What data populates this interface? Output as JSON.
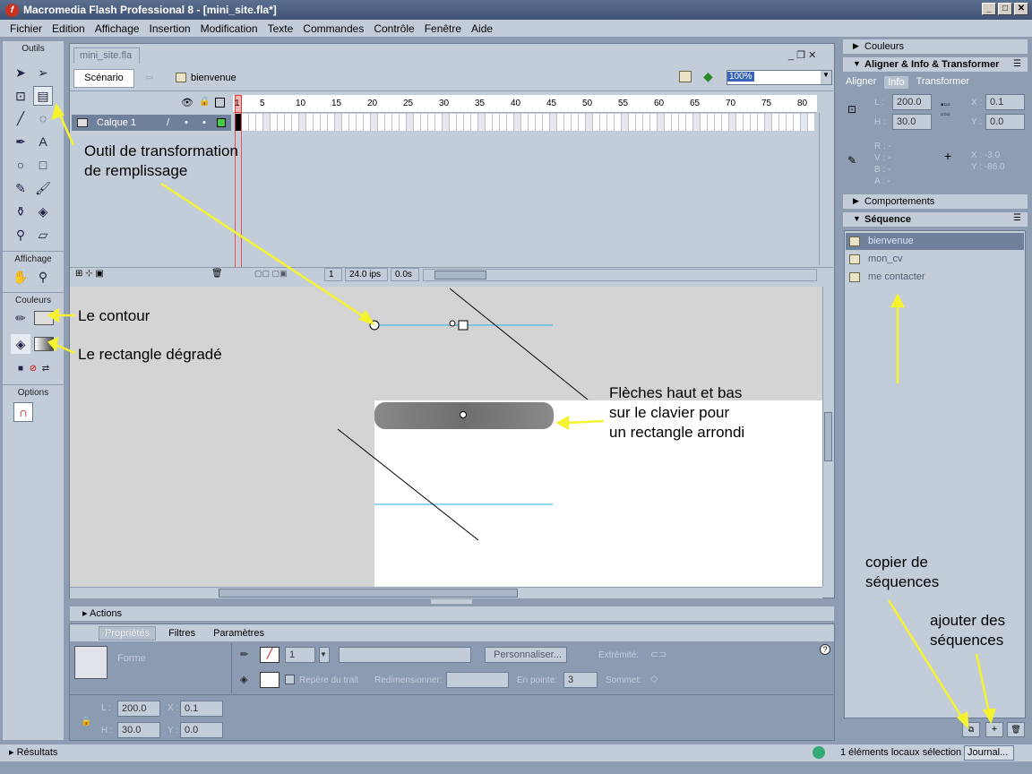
{
  "window": {
    "title": "Macromedia Flash Professional 8 - [mini_site.fla*]"
  },
  "menu": [
    "Fichier",
    "Edition",
    "Affichage",
    "Insertion",
    "Modification",
    "Texte",
    "Commandes",
    "Contrôle",
    "Fenêtre",
    "Aide"
  ],
  "toolbox": {
    "outils": "Outils",
    "affichage": "Affichage",
    "couleurs": "Couleurs",
    "options": "Options"
  },
  "document": {
    "tab": "mini_site.fla",
    "scene_button": "Scénario",
    "scene_name": "bienvenue",
    "zoom": "100%"
  },
  "timeline": {
    "layer": "Calque 1",
    "frame_numbers": [
      "1",
      "5",
      "10",
      "15",
      "20",
      "25",
      "30",
      "35",
      "40",
      "45",
      "50",
      "55",
      "60",
      "65",
      "70",
      "75",
      "80"
    ],
    "current_frame": "1",
    "fps": "24.0 ips",
    "time": "0.0s"
  },
  "actions_label": "Actions",
  "properties": {
    "tabs": [
      "Propriétés",
      "Filtres",
      "Paramètres"
    ],
    "shape_label": "Forme",
    "stroke_width": "1",
    "custom_button": "Personnaliser...",
    "extremite": "Extrémité:",
    "repere": "Repère du trait",
    "redimensionner": "Redimensionner:",
    "en_pointe_label": "En pointe:",
    "en_pointe_value": "3",
    "sommet": "Sommet:",
    "L_label": "L :",
    "L": "200.0",
    "H_label": "H :",
    "H": "30.0",
    "X_label": "X :",
    "X": "0.1",
    "Y_label": "Y :",
    "Y": "0.0"
  },
  "right_panel": {
    "couleurs": "Couleurs",
    "aligner": "Aligner & Info & Transformer",
    "tabs": [
      "Aligner",
      "Info",
      "Transformer"
    ],
    "L_label": "L :",
    "L": "200.0",
    "H_label": "H :",
    "H": "30.0",
    "X_label": "X :",
    "X": "0.1",
    "Y_label": "Y :",
    "Y": "0.0",
    "rgba": [
      "R : -",
      "V : -",
      "B : -",
      "A : -"
    ],
    "cursor_x": "X : -3.0",
    "cursor_y": "Y : -86.0",
    "comportements": "Comportements",
    "sequence": "Séquence",
    "sequences": [
      "bienvenue",
      "mon_cv",
      "me contacter"
    ]
  },
  "status": {
    "results": "Résultats",
    "message": "1 éléments locaux sélection",
    "journal": "Journal..."
  },
  "annotations": {
    "transform": "Outil de transformation\nde remplissage",
    "contour": "Le contour",
    "degrade": "Le rectangle dégradé",
    "fleches": "Flèches haut et bas\nsur le clavier pour\nun rectangle arrondi",
    "copier": "copier de\nséquences",
    "ajouter": "ajouter des\nséquences"
  }
}
